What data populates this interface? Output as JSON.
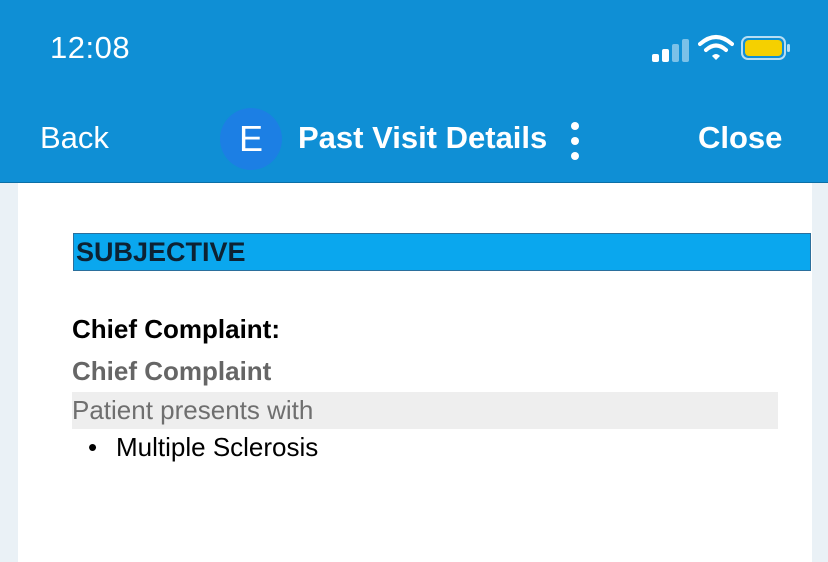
{
  "status_bar": {
    "time": "12:08",
    "icons": [
      "cellular-signal-icon",
      "wifi-icon",
      "battery-icon"
    ],
    "battery_color": "#f5d000"
  },
  "nav": {
    "back_label": "Back",
    "avatar_initial": "E",
    "title": "Past Visit Details",
    "more_icon": "vertical-ellipsis-icon",
    "close_label": "Close"
  },
  "note": {
    "section_title": "SUBJECTIVE",
    "chief_complaint_label": "Chief Complaint:",
    "chief_complaint_heading": "Chief Complaint",
    "intro_text": "Patient presents with",
    "items": [
      "Multiple Sclerosis"
    ]
  },
  "colors": {
    "header": "#0f8fd5",
    "section_bar": "#0aa7ee",
    "highlight_row": "#eeeeee"
  }
}
